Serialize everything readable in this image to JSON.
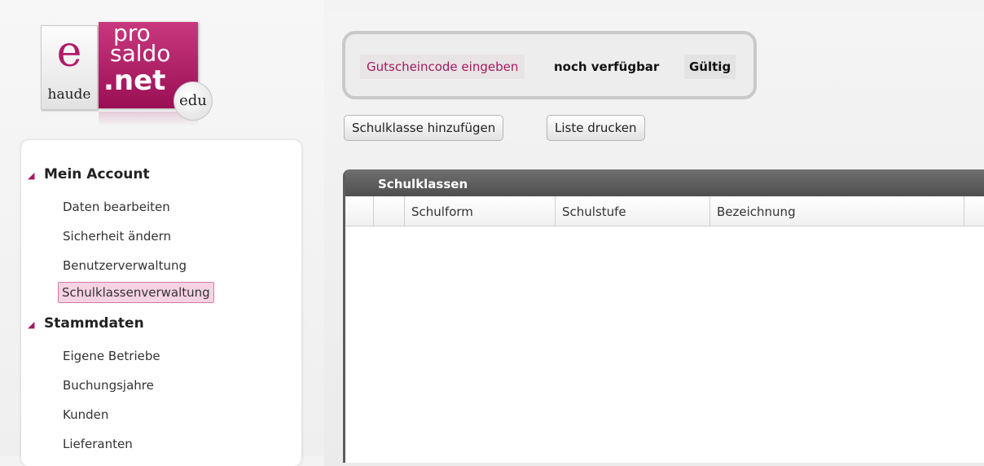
{
  "logo": {
    "e_glyph": "e",
    "brand_left": "haude",
    "line1": "pro",
    "line2": "saldo",
    "line3": ".net",
    "badge": "edu",
    "brand_color": "#a3195f"
  },
  "sidebar": {
    "sections": [
      {
        "title": "Mein Account",
        "items": [
          {
            "label": "Daten bearbeiten"
          },
          {
            "label": "Sicherheit ändern"
          },
          {
            "label": "Benutzerverwaltung"
          },
          {
            "label": "Schulklassenverwaltung",
            "active": true
          }
        ]
      },
      {
        "title": "Stammdaten",
        "items": [
          {
            "label": "Eigene Betriebe"
          },
          {
            "label": "Buchungsjahre"
          },
          {
            "label": "Kunden"
          },
          {
            "label": "Lieferanten"
          }
        ]
      }
    ]
  },
  "voucher": {
    "input_label": "Gutscheincode eingeben",
    "remaining_label": "noch verfügbar",
    "valid_label": "Gültig"
  },
  "toolbar": {
    "add_class_label": "Schulklasse hinzufügen",
    "print_list_label": "Liste drucken"
  },
  "grid": {
    "title": "Schulklassen",
    "columns": [
      "",
      "",
      "Schulform",
      "Schulstufe",
      "Bezeichnung"
    ],
    "rows": []
  }
}
